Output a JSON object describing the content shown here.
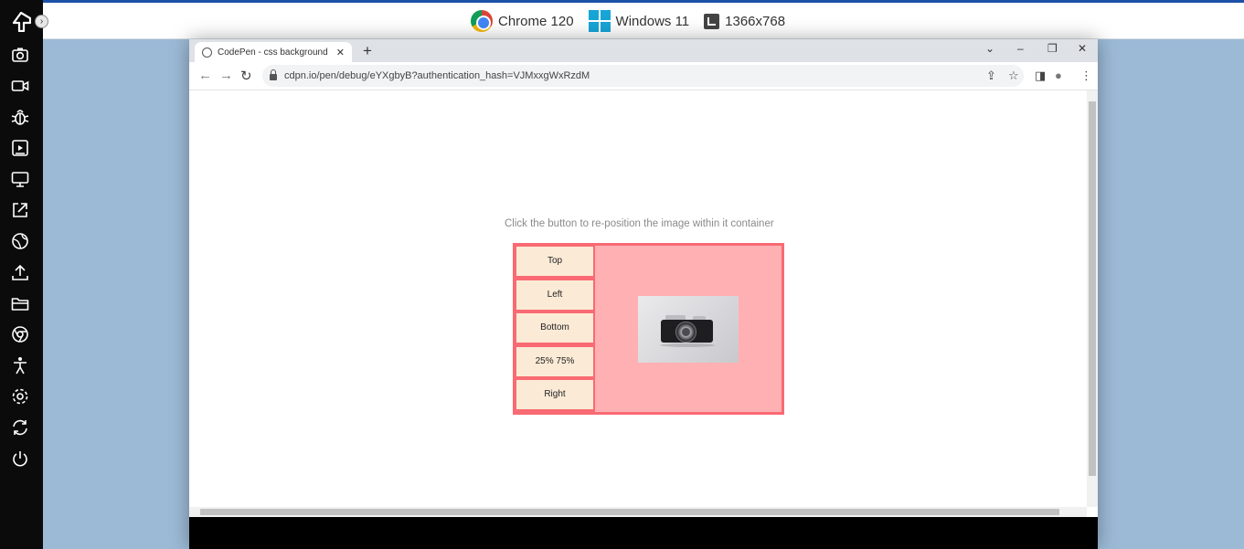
{
  "topbar": {
    "browser": "Chrome 120",
    "os": "Windows 11",
    "resolution": "1366x768"
  },
  "sidebar": {
    "collapse_glyph": "›",
    "icons": [
      "camera-icon",
      "video-icon",
      "bug-icon",
      "tutorial-icon",
      "monitor-icon",
      "external-link-icon",
      "globe-icon",
      "upload-icon",
      "folder-icon",
      "chrome-icon",
      "accessibility-icon",
      "settings-icon",
      "sync-icon",
      "power-icon"
    ]
  },
  "browser": {
    "tab_title": "CodePen - css background posi",
    "tab_close": "✕",
    "new_tab": "+",
    "url": "cdpn.io/pen/debug/eYXgbyB?authentication_hash=VJMxxgWxRzdM",
    "window_controls": {
      "menu": "⌄",
      "minimize": "–",
      "restore": "❐",
      "close": "✕"
    },
    "nav": {
      "back": "←",
      "forward": "→",
      "reload": "↻"
    },
    "toolbar_icons": {
      "share": "⇪",
      "bookmark": "☆",
      "sidepanel": "◨",
      "profile": "●",
      "menu": "⋮"
    }
  },
  "page": {
    "instruction": "Click the button to re-position the image within it container",
    "buttons": [
      "Top",
      "Left",
      "Bottom",
      "25% 75%",
      "Right"
    ]
  },
  "colors": {
    "container_border": "#f96a73",
    "preview_bg": "#ffb0b3",
    "button_bg": "#fbebd6",
    "accent_bar": "#1c4fa8"
  }
}
